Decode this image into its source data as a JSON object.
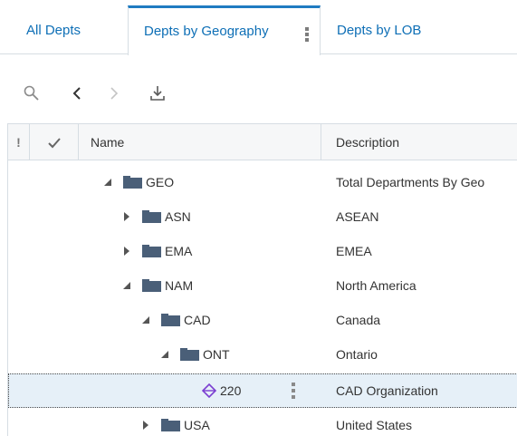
{
  "tabs": [
    {
      "label": "All Depts"
    },
    {
      "label": "Depts by Geography"
    },
    {
      "label": "Depts by LOB"
    }
  ],
  "toolbar": {
    "icons": [
      "search-icon",
      "back-icon",
      "forward-icon",
      "download-icon"
    ]
  },
  "grid": {
    "columns": {
      "flag": "!",
      "check": "",
      "name": "Name",
      "description": "Description"
    },
    "rows": [
      {
        "name": "GEO",
        "description": "Total Departments By Geo",
        "expanded": true,
        "type": "folder"
      },
      {
        "name": "ASN",
        "description": "ASEAN",
        "expanded": false,
        "type": "folder"
      },
      {
        "name": "EMA",
        "description": "EMEA",
        "expanded": false,
        "type": "folder"
      },
      {
        "name": "NAM",
        "description": "North America",
        "expanded": true,
        "type": "folder"
      },
      {
        "name": "CAD",
        "description": "Canada",
        "expanded": true,
        "type": "folder"
      },
      {
        "name": "ONT",
        "description": "Ontario",
        "expanded": true,
        "type": "folder"
      },
      {
        "name": "220",
        "description": "CAD Organization",
        "type": "member",
        "selected": true
      },
      {
        "name": "USA",
        "description": "United States",
        "expanded": false,
        "type": "folder"
      }
    ]
  },
  "colors": {
    "accent": "#1f7bc1",
    "tab_text": "#0e6fb6",
    "folder": "#4a5f78",
    "member_icon": "#7b3fd1",
    "selected_row": "#e6f0f8"
  }
}
